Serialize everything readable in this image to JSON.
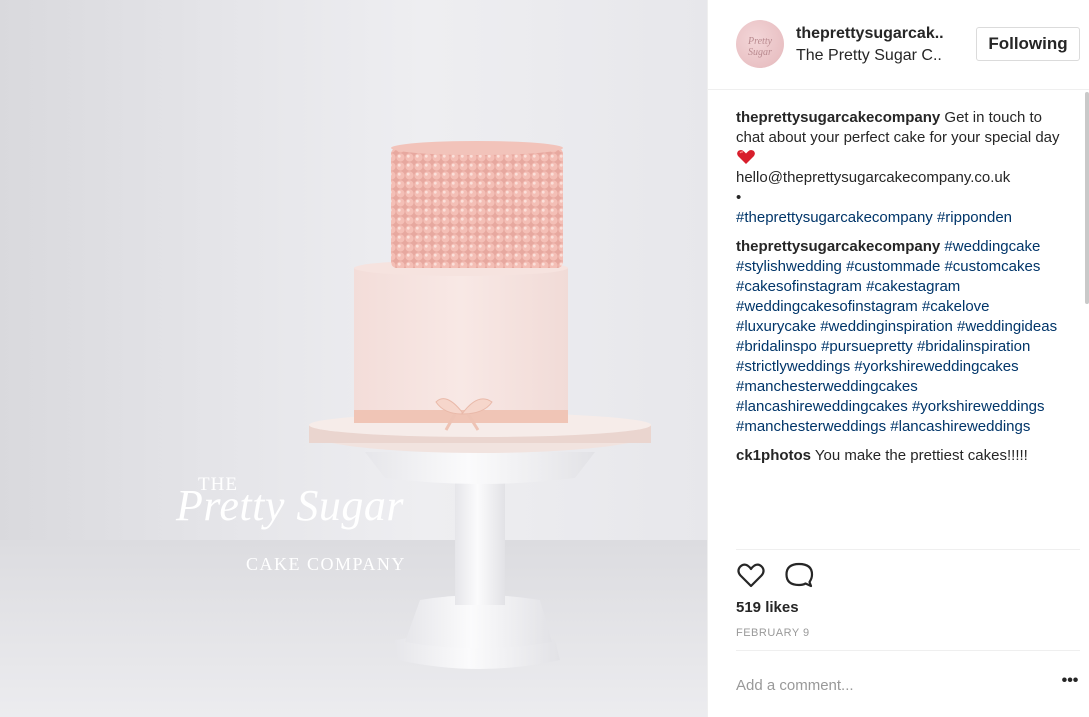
{
  "post": {
    "watermark": {
      "line1": "THE",
      "line2": "Pretty Sugar",
      "line3": "CAKE COMPANY"
    }
  },
  "header": {
    "username": "theprettysugarcak..",
    "full_name": "The Pretty Sugar C..",
    "avatar_text": "Pretty Sugar",
    "follow_label": "Following"
  },
  "comments": [
    {
      "user": "theprettysugarcakecompany",
      "text_before_emoji": "Get in touch to chat about your perfect cake for your special day",
      "emoji": "heart-emoji",
      "email": "hello@theprettysugarcakecompany.co.uk",
      "bullet": "•",
      "hashtags": [
        "#theprettysugarcakecompany",
        "#ripponden"
      ]
    },
    {
      "user": "theprettysugarcakecompany",
      "hashtags": [
        "#weddingcake",
        "#stylishwedding",
        "#custommade",
        "#customcakes",
        "#cakesofinstagram",
        "#cakestagram",
        "#weddingcakesofinstagram",
        "#cakelove",
        "#luxurycake",
        "#weddinginspiration",
        "#weddingideas",
        "#bridalinspo",
        "#pursuepretty",
        "#bridalinspiration",
        "#strictlyweddings",
        "#yorkshireweddingcakes",
        "#manchesterweddingcakes",
        "#lancashireweddingcakes",
        "#yorkshireweddings",
        "#manchesterweddings",
        "#lancashireweddings"
      ]
    },
    {
      "user": "ck1photos",
      "text": "You make the prettiest cakes!!!!!"
    }
  ],
  "actions": {
    "like_icon": "heart-icon",
    "comment_icon": "comment-bubble-icon"
  },
  "likes": {
    "count": "519",
    "suffix": " likes"
  },
  "date": "FEBRUARY 9",
  "add_comment": {
    "placeholder": "Add a comment..."
  },
  "more_label": "•••",
  "colors": {
    "hashtag": "#003569",
    "text": "#262626",
    "muted": "#999999",
    "border": "#dbdbdb"
  }
}
